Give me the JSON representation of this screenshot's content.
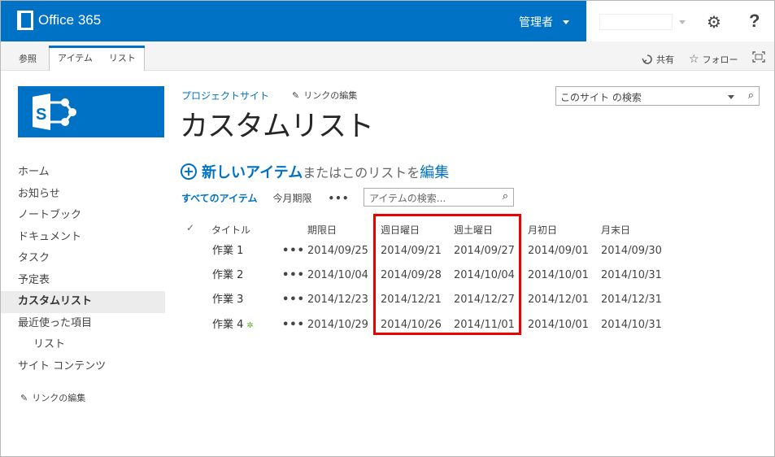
{
  "suite": {
    "brand": "Office 365",
    "admin": "管理者"
  },
  "ribbon": {
    "browse": "参照",
    "tab_item": "アイテム",
    "tab_list": "リスト",
    "share": "共有",
    "follow": "フォロー"
  },
  "nav": {
    "items": [
      {
        "label": "ホーム"
      },
      {
        "label": "お知らせ"
      },
      {
        "label": "ノートブック"
      },
      {
        "label": "ドキュメント"
      },
      {
        "label": "タスク"
      },
      {
        "label": "予定表"
      },
      {
        "label": "カスタムリスト"
      },
      {
        "label": "最近使った項目"
      },
      {
        "label": "リスト"
      },
      {
        "label": "サイト コンテンツ"
      }
    ],
    "edit_links": "リンクの編集"
  },
  "header": {
    "breadcrumb": "プロジェクトサイト",
    "edit_links": "リンクの編集",
    "title": "カスタムリスト",
    "site_search_placeholder": "このサイト の検索"
  },
  "newitem": {
    "new_label": "新しいアイテム",
    "or_text": "またはこのリストを",
    "edit_label": "編集"
  },
  "views": {
    "all": "すべてのアイテム",
    "month": "今月期限",
    "more": "•••",
    "search_placeholder": "アイテムの検索..."
  },
  "list": {
    "columns": [
      "タイトル",
      "期限日",
      "週日曜日",
      "週土曜日",
      "月初日",
      "月末日"
    ],
    "rows": [
      {
        "title": "作業 1",
        "due": "2014/09/25",
        "sun": "2014/09/21",
        "sat": "2014/09/27",
        "first": "2014/09/01",
        "last": "2014/09/30",
        "is_new": false
      },
      {
        "title": "作業 2",
        "due": "2014/10/04",
        "sun": "2014/09/28",
        "sat": "2014/10/04",
        "first": "2014/10/01",
        "last": "2014/10/31",
        "is_new": false
      },
      {
        "title": "作業 3",
        "due": "2014/12/23",
        "sun": "2014/12/21",
        "sat": "2014/12/27",
        "first": "2014/12/01",
        "last": "2014/12/31",
        "is_new": false
      },
      {
        "title": "作業 4",
        "due": "2014/10/29",
        "sun": "2014/10/26",
        "sat": "2014/11/01",
        "first": "2014/10/01",
        "last": "2014/10/31",
        "is_new": true
      }
    ],
    "ellipsis": "•••"
  },
  "colors": {
    "suite_blue": "#0072c6",
    "highlight_red": "#ee0000"
  }
}
